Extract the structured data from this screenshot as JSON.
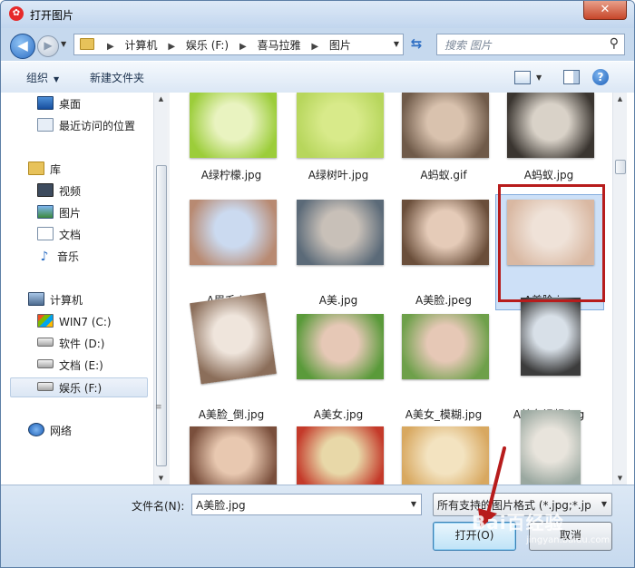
{
  "window": {
    "title": "打开图片",
    "app_icon": "app-logo-icon",
    "close_label": "✕"
  },
  "navigation": {
    "breadcrumbs": [
      "计算机",
      "娱乐 (F:)",
      "喜马拉雅",
      "图片"
    ],
    "search_placeholder": "搜索 图片"
  },
  "toolbar": {
    "organize_label": "组织",
    "new_folder_label": "新建文件夹"
  },
  "nav_pane": {
    "favorites": [
      {
        "label": "桌面",
        "icon": "desktop-icon"
      },
      {
        "label": "最近访问的位置",
        "icon": "recent-places-icon"
      }
    ],
    "libraries_label": "库",
    "libraries": [
      {
        "label": "视频",
        "icon": "video-library-icon"
      },
      {
        "label": "图片",
        "icon": "pictures-library-icon"
      },
      {
        "label": "文档",
        "icon": "documents-library-icon"
      },
      {
        "label": "音乐",
        "icon": "music-library-icon"
      }
    ],
    "computer_label": "计算机",
    "drives": [
      {
        "label": "WIN7 (C:)",
        "icon": "windows-drive-icon"
      },
      {
        "label": "软件 (D:)",
        "icon": "drive-icon"
      },
      {
        "label": "文档 (E:)",
        "icon": "drive-icon"
      },
      {
        "label": "娱乐 (F:)",
        "icon": "drive-icon",
        "selected": true
      }
    ],
    "network_label": "网络"
  },
  "files": [
    {
      "name": "A绿柠檬.jpg",
      "thumb_colors": [
        "#9ccd3a",
        "#e9f3c0"
      ]
    },
    {
      "name": "A绿树叶.jpg",
      "thumb_colors": [
        "#b7d65c",
        "#d8ea8a"
      ]
    },
    {
      "name": "A蚂蚁.gif",
      "thumb_colors": [
        "#6f5a49",
        "#d9c2ae"
      ]
    },
    {
      "name": "A蚂蚁.jpg",
      "thumb_colors": [
        "#3a3530",
        "#d9d2c8"
      ]
    },
    {
      "name": "A眉毛.jpg",
      "thumb_colors": [
        "#b88a72",
        "#cbdaf0"
      ]
    },
    {
      "name": "A美.jpg",
      "thumb_colors": [
        "#5b6a78",
        "#c8c0b8"
      ]
    },
    {
      "name": "A美脸.jpeg",
      "thumb_colors": [
        "#6a4e3a",
        "#e5cbb8"
      ]
    },
    {
      "name": "A美脸.jpg",
      "thumb_colors": [
        "#d9b8a2",
        "#efe2d8"
      ],
      "selected": true
    },
    {
      "name": "A美脸_倒.jpg",
      "thumb_colors": [
        "#8b6e5a",
        "#efe5dc"
      ]
    },
    {
      "name": "A美女.jpg",
      "thumb_colors": [
        "#5a9a3a",
        "#e6c8b6"
      ]
    },
    {
      "name": "A美女_模糊.jpg",
      "thumb_colors": [
        "#6ea04a",
        "#e6c8b6"
      ]
    },
    {
      "name": "A美女视频.jpg",
      "thumb_colors": [
        "#3c3c3c",
        "#d8e0e8"
      ]
    },
    {
      "name": "",
      "thumb_colors": [
        "#7a4f3c",
        "#e8c8b0"
      ]
    },
    {
      "name": "",
      "thumb_colors": [
        "#c43a2a",
        "#e8d8a8"
      ]
    },
    {
      "name": "",
      "thumb_colors": [
        "#d8a860",
        "#f3e3c0"
      ]
    },
    {
      "name": "",
      "thumb_colors": [
        "#9aa8a0",
        "#e8e4dc"
      ]
    }
  ],
  "bottom": {
    "filename_label": "文件名(N):",
    "filename_value": "A美脸.jpg",
    "file_type": "所有支持的图片格式 (*.jpg;*.jp",
    "open_label": "打开(O)",
    "cancel_label": "取消"
  },
  "watermark": {
    "brand": "Bai百经验",
    "url": "jingyan.baidu.com"
  },
  "colors": {
    "accent": "#2e6fc4",
    "highlight_border": "#b71c1c",
    "selection": "#cde0f7"
  }
}
